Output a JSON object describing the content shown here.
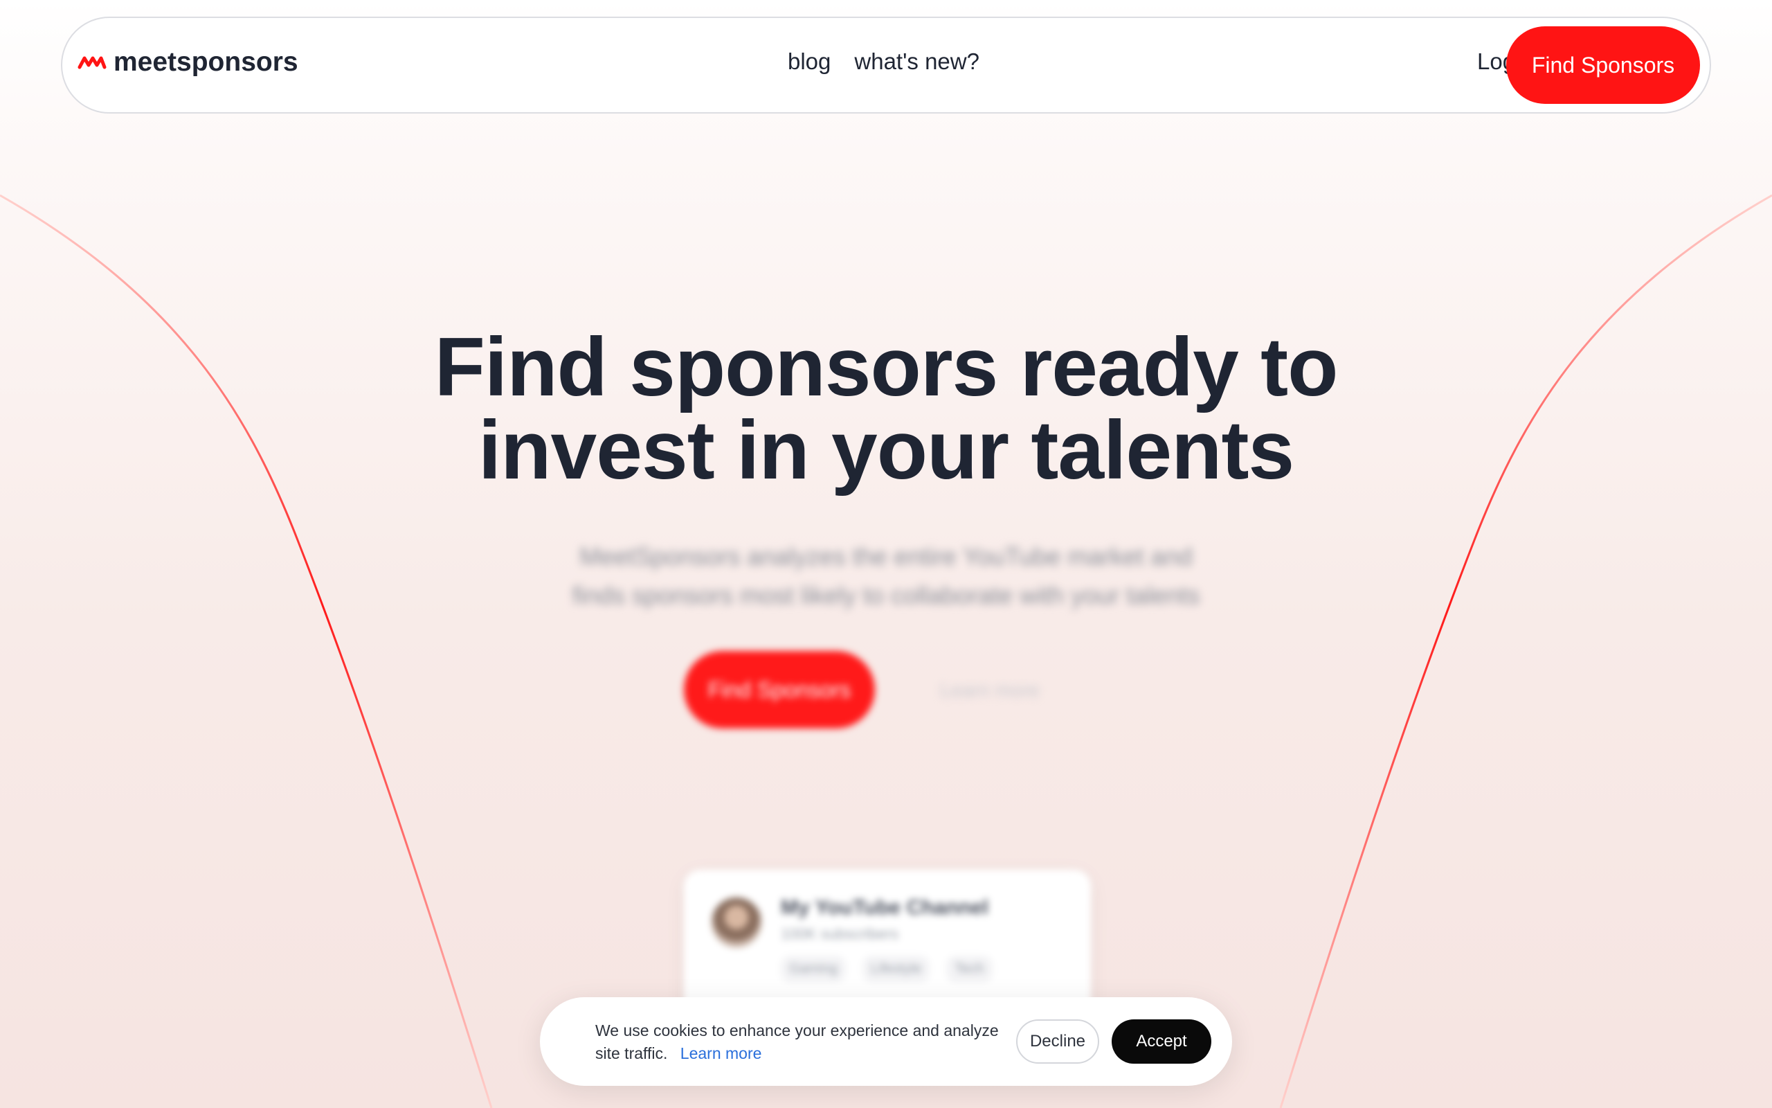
{
  "brand": {
    "name": "meetsponsors",
    "accent_color": "#ff1414",
    "text_color": "#1f2533"
  },
  "nav": {
    "links": [
      "blog",
      "what's new?"
    ],
    "login_label": "Login",
    "cta_label": "Find Sponsors"
  },
  "hero": {
    "headline_line1": "Find sponsors ready to",
    "headline_line2": "invest in your talents",
    "subhead_line1": "MeetSponsors analyzes the entire YouTube market and",
    "subhead_line2": "finds sponsors most likely to collaborate with your talents",
    "cta_label": "Find Sponsors",
    "secondary_label": "Learn more"
  },
  "preview_card": {
    "title": "My YouTube Channel",
    "subtitle": "100K subscribers",
    "tags": [
      "Gaming",
      "Lifestyle",
      "Tech"
    ]
  },
  "cookie_banner": {
    "text": "We use cookies to enhance your experience and analyze site traffic.",
    "link_label": "Learn more",
    "decline_label": "Decline",
    "accept_label": "Accept"
  }
}
